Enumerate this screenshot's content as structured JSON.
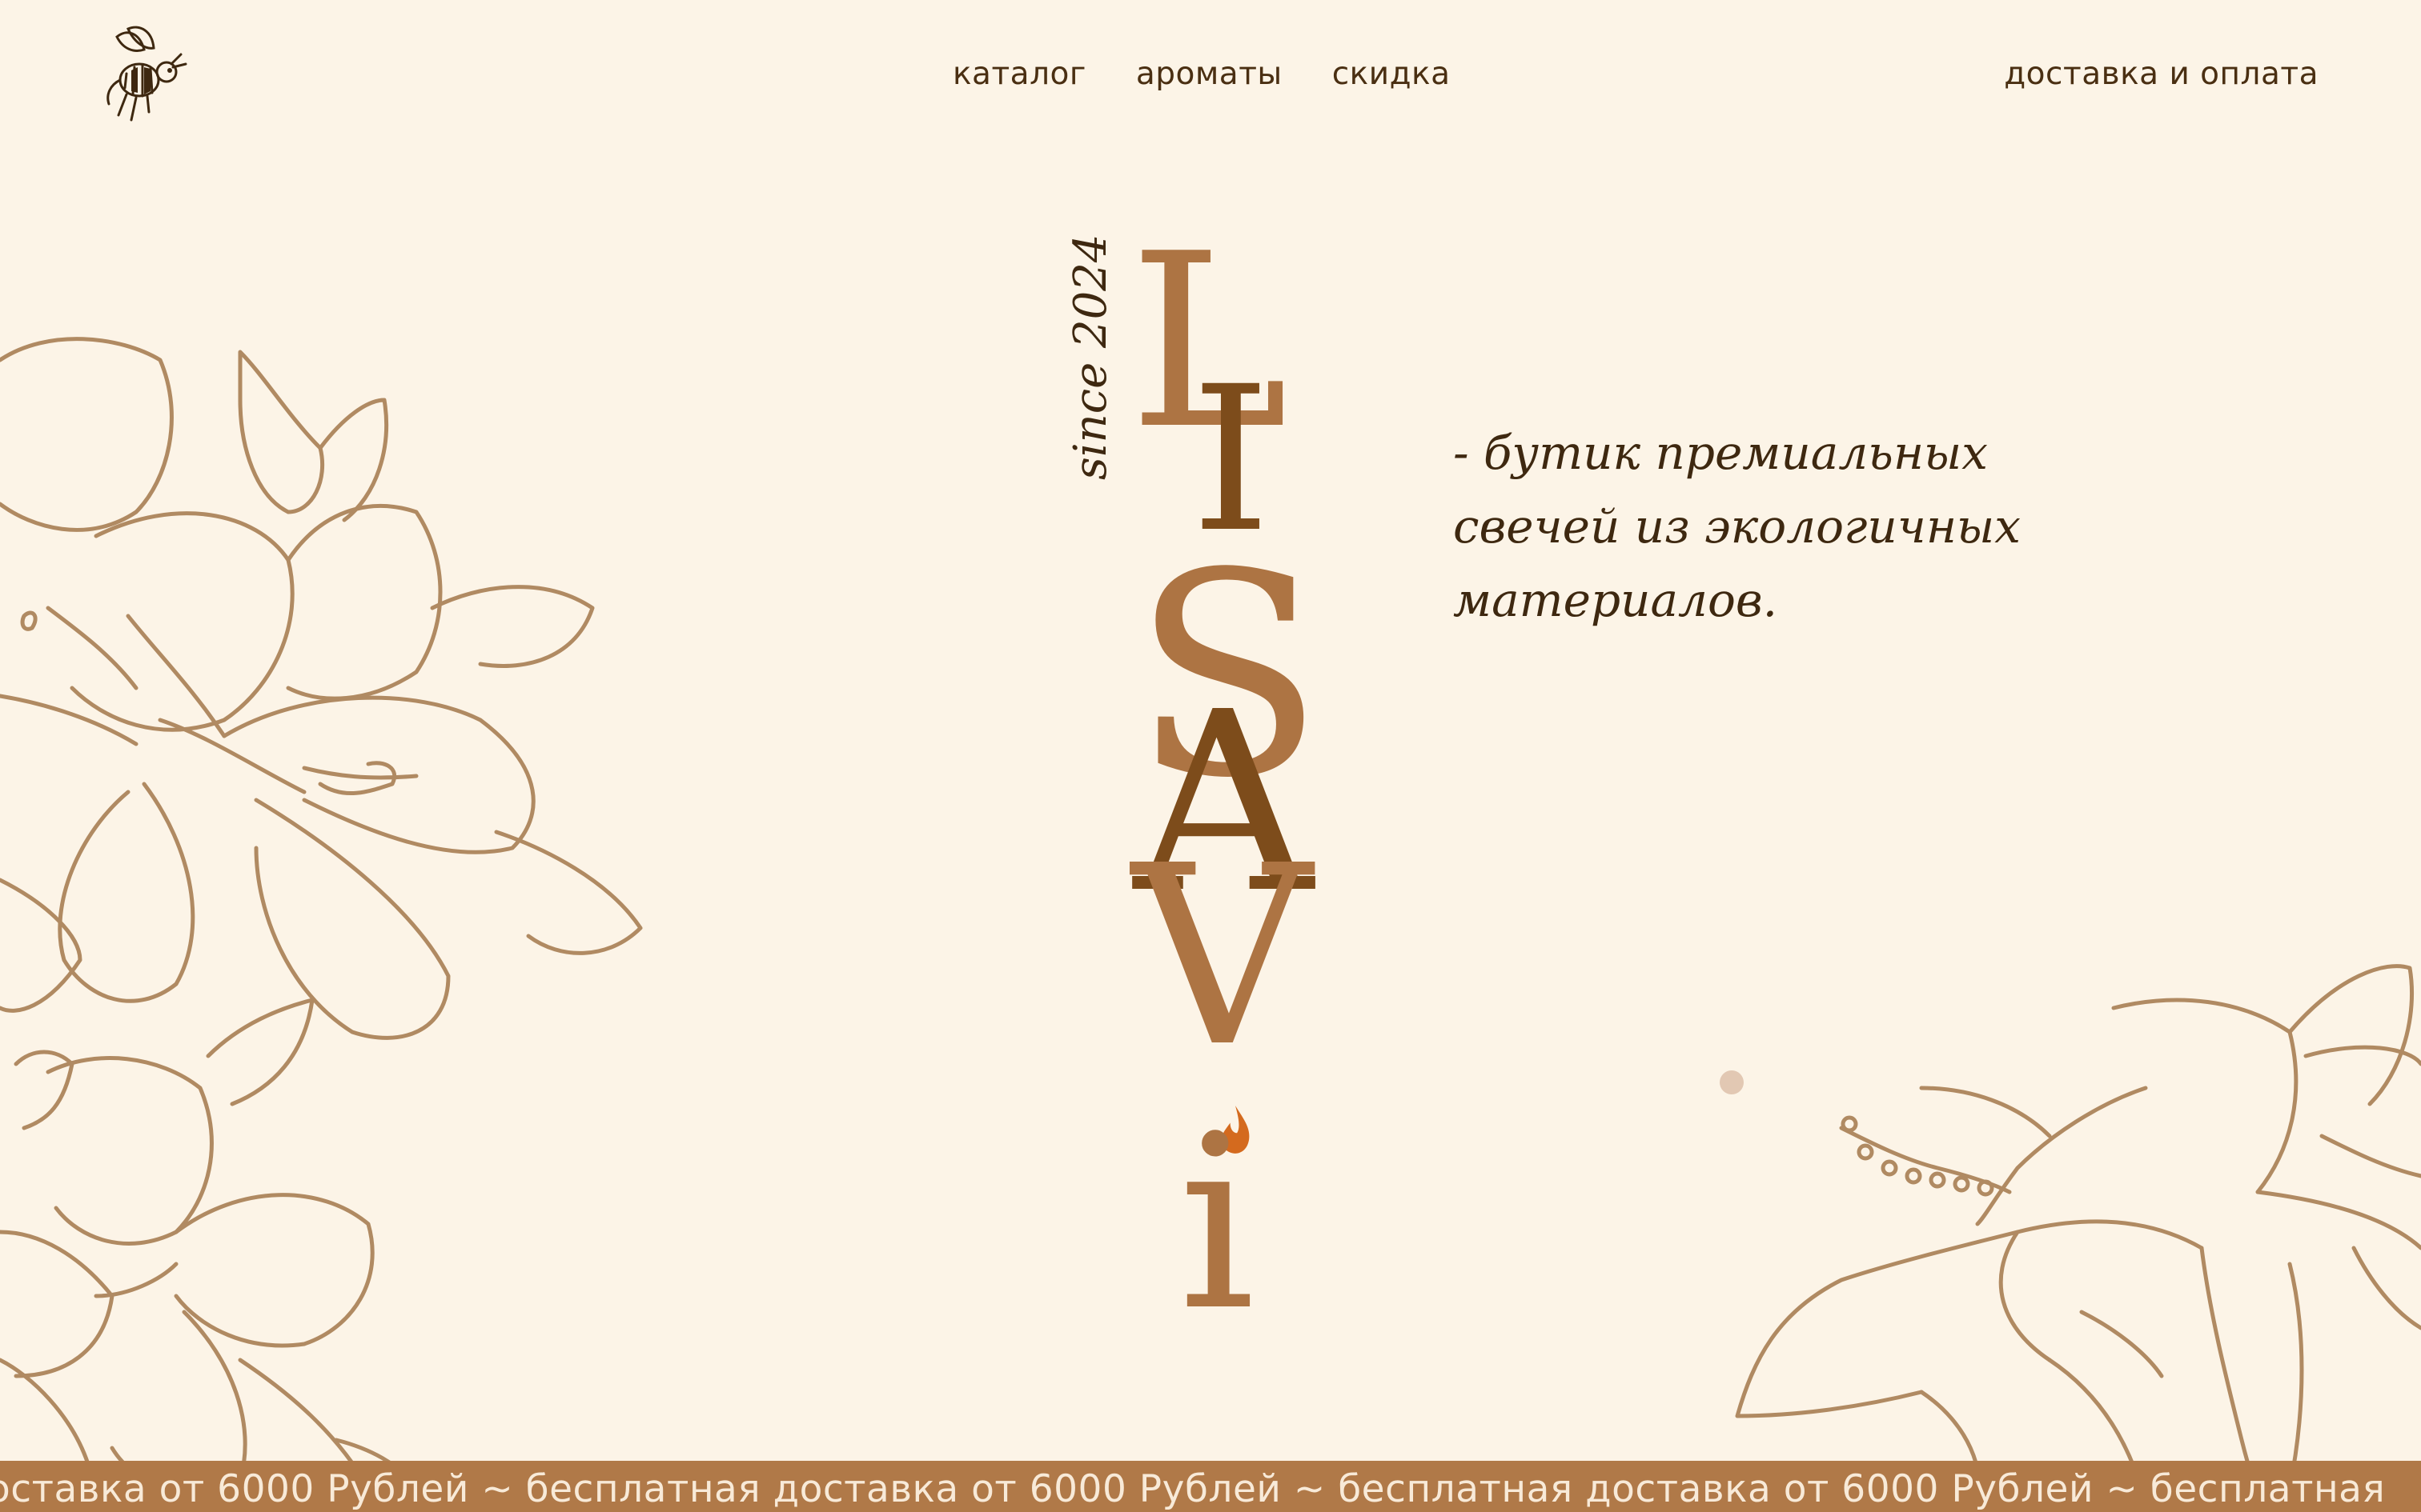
{
  "nav": {
    "catalog": "каталог",
    "aromas": "ароматы",
    "discount": "скидка",
    "delivery": "доставка и оплата"
  },
  "brand": {
    "letters": [
      "L",
      "I",
      "S",
      "A",
      "V",
      "i"
    ],
    "since": "since 2024"
  },
  "tagline": {
    "line1": "- бутик премиальных",
    "line2": "свечей из экологичных",
    "line3": "материалов."
  },
  "marquee": {
    "text": "оставка от 6000 Рублей ~ бесплатная доставка от 6000 Рублей ~ бесплатная доставка от 6000 Рублей ~ бесплатная"
  },
  "colors": {
    "background": "#fcf4e7",
    "text": "#4a2f12",
    "brand_light": "#ad7443",
    "brand_dark": "#7d4c1b",
    "marquee_bg": "#b07948",
    "flame": "#d46a1e"
  },
  "icons": {
    "logo": "bee-icon",
    "flame": "flame-icon"
  }
}
